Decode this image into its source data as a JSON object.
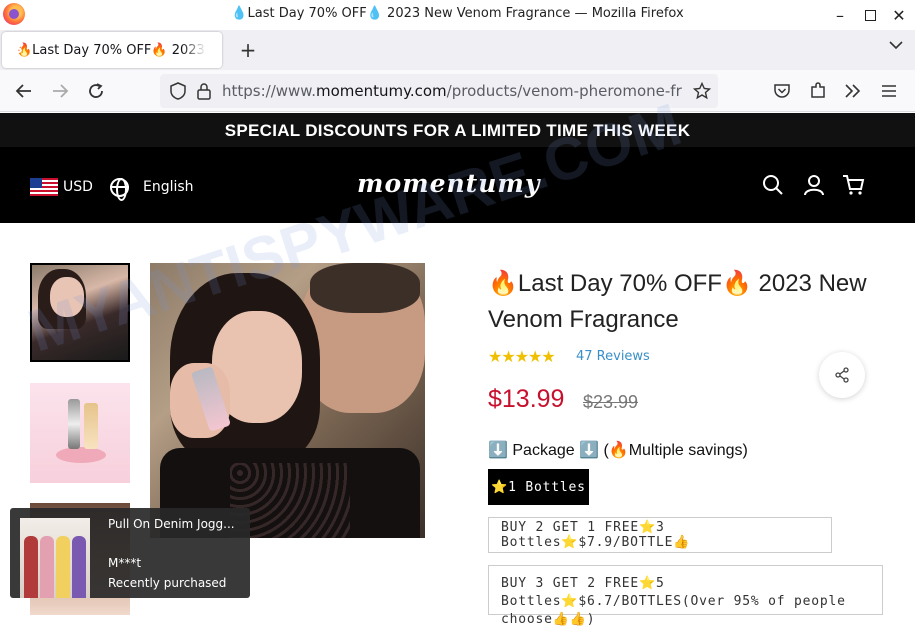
{
  "browser": {
    "window_title": "💧Last Day 70% OFF💧 2023 New Venom Fragrance — Mozilla Firefox",
    "tab_title": "🔥Last Day 70% OFF🔥 2023 New Venom Fragrance",
    "url_prefix": "https://www.",
    "url_domain": "momentumy.com",
    "url_path": "/products/venom-pheromone-fragrance",
    "icons": [
      "firefox-logo",
      "minimize",
      "maximize",
      "close",
      "new-tab",
      "list-all-tabs",
      "back",
      "forward",
      "reload",
      "shield",
      "lock",
      "bookmark-star",
      "pocket",
      "extensions",
      "overflow",
      "menu"
    ]
  },
  "site": {
    "promo_text": "SPECIAL DISCOUNTS FOR A LIMITED TIME THIS WEEK",
    "currency": "USD",
    "language": "English",
    "logo": "momentumy",
    "header_icons": [
      "search-icon",
      "account-icon",
      "cart-icon"
    ]
  },
  "product": {
    "title": "🔥Last Day 70% OFF🔥 2023 New Venom Fragrance",
    "rating": 5,
    "stars": "★★★★★",
    "reviews": "47 Reviews",
    "price": "$13.99",
    "compare_price": "$23.99",
    "package_label": "⬇️ Package ⬇️ (🔥Multiple savings)",
    "options": [
      "⭐1 Bottles",
      "BUY 2 GET 1 FREE⭐3 Bottles⭐$7.9/BOTTLE👍",
      "BUY 3 GET 2 FREE⭐5 Bottles⭐$6.7/BOTTLES(Over 95% of people choose👍👍)"
    ],
    "selected_option": "⭐1 Bottles"
  },
  "toast": {
    "product": "Pull On Denim Jogg...",
    "user": "M***t",
    "status": "Recently purchased"
  },
  "watermark": "MYANTISPYWARE.COM",
  "colors": {
    "price_red": "#c8102e",
    "star_gold": "#f0c000",
    "review_link": "#3a8fc7",
    "header_bg": "#000000"
  }
}
